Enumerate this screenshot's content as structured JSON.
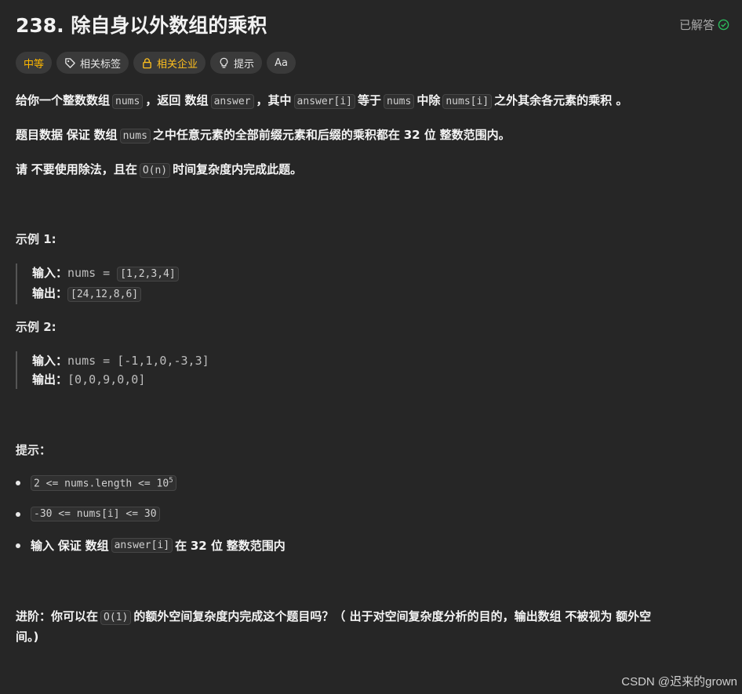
{
  "header": {
    "title": "238. 除自身以外数组的乘积",
    "solved_label": "已解答"
  },
  "tags": {
    "difficulty": "中等",
    "topics": "相关标签",
    "companies": "相关企业",
    "hints": "提示",
    "font_toggle": "Aa"
  },
  "description": {
    "p1": {
      "t1": "给你一个整数数组",
      "c1": "nums",
      "t2": "，返回 数组",
      "c2": "answer",
      "t3": "，其中",
      "c3": "answer[i]",
      "t4": "等于",
      "c4": "nums",
      "t5": "中除",
      "c5": "nums[i]",
      "t6": "之外其余各元素的乘积 。"
    },
    "p2": {
      "t1": "题目数据",
      "b1": "保证",
      "t2": "数组",
      "c1": "nums",
      "t3": "之中任意元素的全部前缀元素和后缀的乘积都在",
      "b2": "32 位",
      "t4": "整数范围内。"
    },
    "p3": {
      "t1": "请",
      "b1": "不要使用除法，",
      "t2": "且在",
      "c1": "O(n)",
      "t3": "时间复杂度内完成此题。"
    }
  },
  "examples": [
    {
      "heading": "示例 1:",
      "input_label": "输入：",
      "input_prefix": "nums = ",
      "input_value": "[1,2,3,4]",
      "output_label": "输出：",
      "output_value": "[24,12,8,6]"
    },
    {
      "heading": "示例 2:",
      "input_label": "输入：",
      "input_value": "nums = [-1,1,0,-3,3]",
      "output_label": "输出：",
      "output_value": "[0,0,9,0,0]"
    }
  ],
  "constraints": {
    "heading": "提示：",
    "c1_base": "2 <= nums.length <= 10",
    "c1_exp": "5",
    "c2": "-30 <= nums[i] <= 30",
    "c3_t1": "输入",
    "c3_b1": "保证",
    "c3_t2": "数组",
    "c3_code": "answer[i]",
    "c3_t3": "在",
    "c3_b2": "32 位",
    "c3_t4": "整数范围内"
  },
  "followup": {
    "label": "进阶：",
    "t1": "你可以在",
    "code": "O(1)",
    "t2": "的额外空间复杂度内完成这个题目吗？（ 出于对空间复杂度分析的目的，输出数组",
    "b1": "不被视为",
    "t3": "额外空",
    "t4": "间。)"
  },
  "watermark": "CSDN @迟来的grown",
  "colors": {
    "background": "#262626",
    "difficulty": "#ffb800",
    "solved_check": "#2cbb5d"
  },
  "icons": [
    "tag-icon",
    "lock-icon",
    "lightbulb-icon",
    "translate-icon",
    "check-circle-icon"
  ]
}
